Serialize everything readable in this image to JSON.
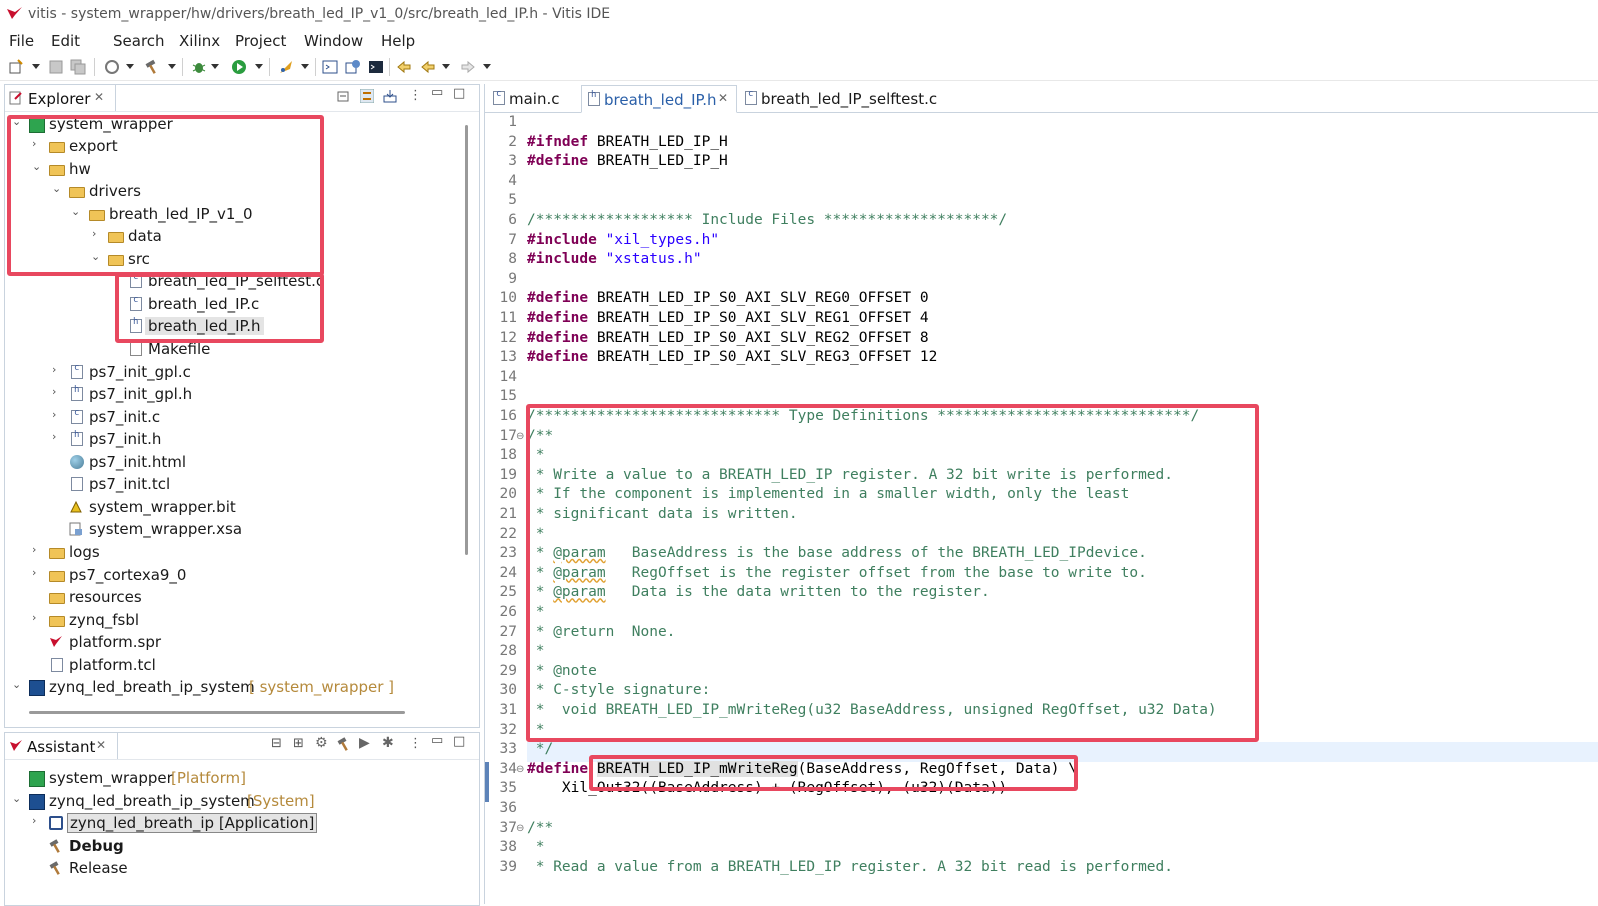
{
  "window": {
    "title": "vitis - system_wrapper/hw/drivers/breath_led_IP_v1_0/src/breath_led_IP.h - Vitis IDE"
  },
  "menu": [
    "File",
    "Edit",
    "Search",
    "Xilinx",
    "Project",
    "Window",
    "Help"
  ],
  "explorer": {
    "title": "Explorer",
    "tree": [
      {
        "label": "system_wrapper",
        "icon": "project-icon",
        "expanded": true
      },
      {
        "label": "export",
        "icon": "folder-icon"
      },
      {
        "label": "hw",
        "icon": "folder-icon",
        "expanded": true
      },
      {
        "label": "drivers",
        "icon": "folder-icon",
        "expanded": true
      },
      {
        "label": "breath_led_IP_v1_0",
        "icon": "folder-icon",
        "expanded": true
      },
      {
        "label": "data",
        "icon": "folder-icon"
      },
      {
        "label": "src",
        "icon": "folder-icon",
        "expanded": true
      },
      {
        "label": "breath_led_IP_selftest.c",
        "icon": "c-file-icon"
      },
      {
        "label": "breath_led_IP.c",
        "icon": "c-file-icon"
      },
      {
        "label": "breath_led_IP.h",
        "icon": "h-file-icon",
        "selected": true
      },
      {
        "label": "Makefile",
        "icon": "makefile-icon"
      },
      {
        "label": "ps7_init_gpl.c",
        "icon": "c-file-icon"
      },
      {
        "label": "ps7_init_gpl.h",
        "icon": "h-file-icon"
      },
      {
        "label": "ps7_init.c",
        "icon": "c-file-icon"
      },
      {
        "label": "ps7_init.h",
        "icon": "h-file-icon"
      },
      {
        "label": "ps7_init.html",
        "icon": "html-icon"
      },
      {
        "label": "ps7_init.tcl",
        "icon": "text-file-icon"
      },
      {
        "label": "system_wrapper.bit",
        "icon": "bitstream-icon"
      },
      {
        "label": "system_wrapper.xsa",
        "icon": "xsa-icon"
      },
      {
        "label": "logs",
        "icon": "folder-icon"
      },
      {
        "label": "ps7_cortexa9_0",
        "icon": "folder-icon"
      },
      {
        "label": "resources",
        "icon": "folder-icon"
      },
      {
        "label": "zynq_fsbl",
        "icon": "folder-icon"
      },
      {
        "label": "platform.spr",
        "icon": "vitis-icon"
      },
      {
        "label": "platform.tcl",
        "icon": "text-file-icon"
      },
      {
        "label": "zynq_led_breath_ip_system",
        "decoration": "[ system_wrapper ]",
        "icon": "system-icon",
        "expanded": true
      }
    ]
  },
  "assistant": {
    "title": "Assistant",
    "tree": [
      {
        "label": "system_wrapper",
        "decoration": "[Platform]",
        "icon": "project-icon"
      },
      {
        "label": "zynq_led_breath_ip_system",
        "decoration": "[System]",
        "icon": "system-icon"
      },
      {
        "label": "zynq_led_breath_ip [Application]",
        "icon": "application-icon",
        "selected": true
      },
      {
        "label": "Debug",
        "icon": "hammer-icon",
        "bold": true
      },
      {
        "label": "Release",
        "icon": "hammer-icon"
      }
    ]
  },
  "editor": {
    "tabs": [
      {
        "label": "main.c"
      },
      {
        "label": "breath_led_IP.h",
        "active": true
      },
      {
        "label": "breath_led_IP_selftest.c"
      }
    ],
    "lines": [
      {
        "n": "1",
        "t": ""
      },
      {
        "n": "2",
        "t": "#ifndef BREATH_LED_IP_H"
      },
      {
        "n": "3",
        "t": "#define BREATH_LED_IP_H"
      },
      {
        "n": "4",
        "t": ""
      },
      {
        "n": "5",
        "t": ""
      },
      {
        "n": "6",
        "t": "/****************** Include Files ********************/"
      },
      {
        "n": "7",
        "t": "#include \"xil_types.h\""
      },
      {
        "n": "8",
        "t": "#include \"xstatus.h\""
      },
      {
        "n": "9",
        "t": ""
      },
      {
        "n": "10",
        "t": "#define BREATH_LED_IP_S0_AXI_SLV_REG0_OFFSET 0"
      },
      {
        "n": "11",
        "t": "#define BREATH_LED_IP_S0_AXI_SLV_REG1_OFFSET 4"
      },
      {
        "n": "12",
        "t": "#define BREATH_LED_IP_S0_AXI_SLV_REG2_OFFSET 8"
      },
      {
        "n": "13",
        "t": "#define BREATH_LED_IP_S0_AXI_SLV_REG3_OFFSET 12"
      },
      {
        "n": "14",
        "t": ""
      },
      {
        "n": "15",
        "t": ""
      },
      {
        "n": "16",
        "t": "/**************************** Type Definitions *****************************/"
      },
      {
        "n": "17",
        "t": "/**"
      },
      {
        "n": "18",
        "t": " *"
      },
      {
        "n": "19",
        "t": " * Write a value to a BREATH_LED_IP register. A 32 bit write is performed."
      },
      {
        "n": "20",
        "t": " * If the component is implemented in a smaller width, only the least"
      },
      {
        "n": "21",
        "t": " * significant data is written."
      },
      {
        "n": "22",
        "t": " *"
      },
      {
        "n": "23",
        "t": " * @param   BaseAddress is the base address of the BREATH_LED_IPdevice."
      },
      {
        "n": "24",
        "t": " * @param   RegOffset is the register offset from the base to write to."
      },
      {
        "n": "25",
        "t": " * @param   Data is the data written to the register."
      },
      {
        "n": "26",
        "t": " *"
      },
      {
        "n": "27",
        "t": " * @return  None."
      },
      {
        "n": "28",
        "t": " *"
      },
      {
        "n": "29",
        "t": " * @note"
      },
      {
        "n": "30",
        "t": " * C-style signature:"
      },
      {
        "n": "31",
        "t": " *  void BREATH_LED_IP_mWriteReg(u32 BaseAddress, unsigned RegOffset, u32 Data)"
      },
      {
        "n": "32",
        "t": " *"
      },
      {
        "n": "33",
        "t": " */"
      },
      {
        "n": "34",
        "t": "#define BREATH_LED_IP_mWriteReg(BaseAddress, RegOffset, Data) \\"
      },
      {
        "n": "35",
        "t": "    Xil_Out32((BaseAddress) + (RegOffset), (u32)(Data))"
      },
      {
        "n": "36",
        "t": ""
      },
      {
        "n": "37",
        "t": "/**"
      },
      {
        "n": "38",
        "t": " *"
      },
      {
        "n": "39",
        "t": " * Read a value from a BREATH_LED_IP register. A 32 bit read is performed."
      }
    ]
  }
}
